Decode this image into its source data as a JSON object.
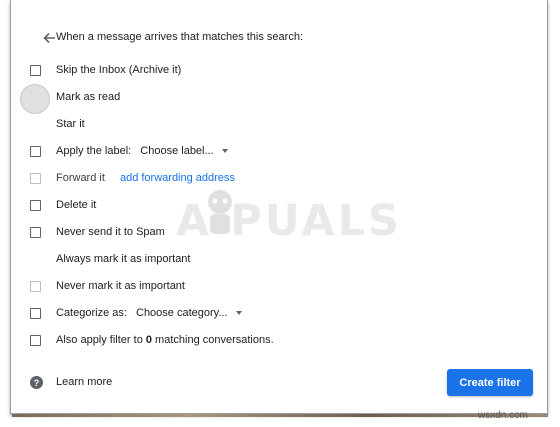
{
  "header": {
    "title": "When a message arrives that matches this search:"
  },
  "options": [
    {
      "id": "skip-inbox",
      "label": "Skip the Inbox (Archive it)"
    },
    {
      "id": "mark-read",
      "label": "Mark as read"
    },
    {
      "id": "star",
      "label": "Star it"
    },
    {
      "id": "apply-label",
      "label": "Apply the label:",
      "select": "Choose label..."
    },
    {
      "id": "forward",
      "label": "Forward it",
      "link": "add forwarding address"
    },
    {
      "id": "delete",
      "label": "Delete it"
    },
    {
      "id": "never-spam",
      "label": "Never send it to Spam"
    },
    {
      "id": "always-important",
      "label": "Always mark it as important"
    },
    {
      "id": "never-important",
      "label": "Never mark it as important"
    },
    {
      "id": "categorize",
      "label": "Categorize as:",
      "select": "Choose category..."
    },
    {
      "id": "also-apply",
      "label_prefix": "Also apply filter to ",
      "count": "0",
      "label_suffix": " matching conversations."
    }
  ],
  "footer": {
    "help_glyph": "?",
    "learn_more": "Learn more",
    "create_filter": "Create filter"
  },
  "watermark": {
    "text": "A  PUALS"
  },
  "site": "wsxdn.com",
  "colors": {
    "primary": "#1a73e8",
    "text": "#202124",
    "icon": "#5f6368"
  }
}
